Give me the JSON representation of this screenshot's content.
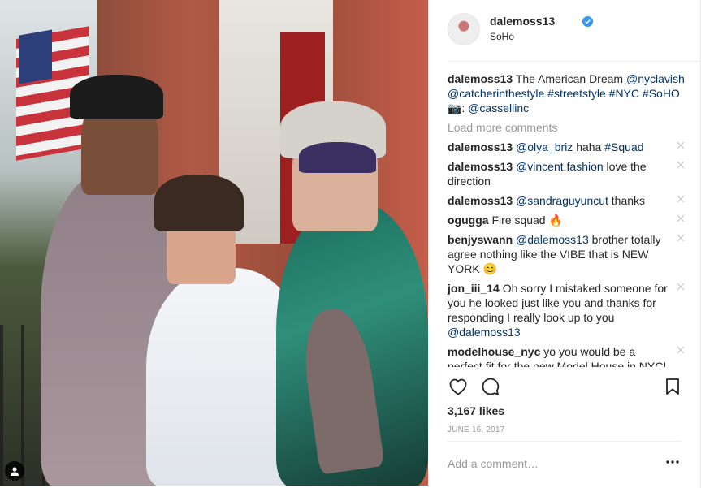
{
  "post": {
    "username": "dalemoss13",
    "verified": true,
    "location": "SoHo",
    "caption": {
      "user": "dalemoss13",
      "text_1": "The American Dream ",
      "mention_1": "@nyclavish",
      "mention_2": "@catcherinthestyle",
      "hashtag_1": "#streetstyle",
      "hashtag_2": "#NYC",
      "hashtag_3": "#SoHO",
      "camera_text": " 📷: ",
      "mention_3": "@cassellinc"
    },
    "load_more": "Load more comments",
    "comments": [
      {
        "user": "dalemoss13",
        "mention": "@olya_briz",
        "text": " haha ",
        "hashtag": "#Squad"
      },
      {
        "user": "dalemoss13",
        "mention": "@vincent.fashion",
        "text": " love the direction"
      },
      {
        "user": "dalemoss13",
        "mention": "@sandraguyuncut",
        "text": " thanks"
      },
      {
        "user": "ogugga",
        "text": "Fire squad 🔥"
      },
      {
        "user": "benjyswann",
        "mention": "@dalemoss13",
        "text": " brother totally agree nothing like the VIBE that is NEW YORK 😊"
      },
      {
        "user": "jon_iii_14",
        "text": "Oh sorry I mistaked someone for you he looked just like you and thanks for responding I really look up to you ",
        "mention": "@dalemoss13"
      },
      {
        "user": "modelhouse_nyc",
        "text": "yo you would be a perfect fit for the new Model House in NYC!"
      }
    ],
    "likes": "3,167 likes",
    "date": "JUNE 16, 2017",
    "add_comment_placeholder": "Add a comment…"
  },
  "icons": {
    "like": "heart-outline-icon",
    "comment": "speech-bubble-icon",
    "save": "bookmark-icon",
    "more": "ellipsis-icon",
    "verified": "verified-badge-icon",
    "user_tag": "person-icon"
  },
  "colors": {
    "link": "#003569",
    "verified": "#3897f0",
    "muted": "#999999",
    "text": "#262626"
  }
}
